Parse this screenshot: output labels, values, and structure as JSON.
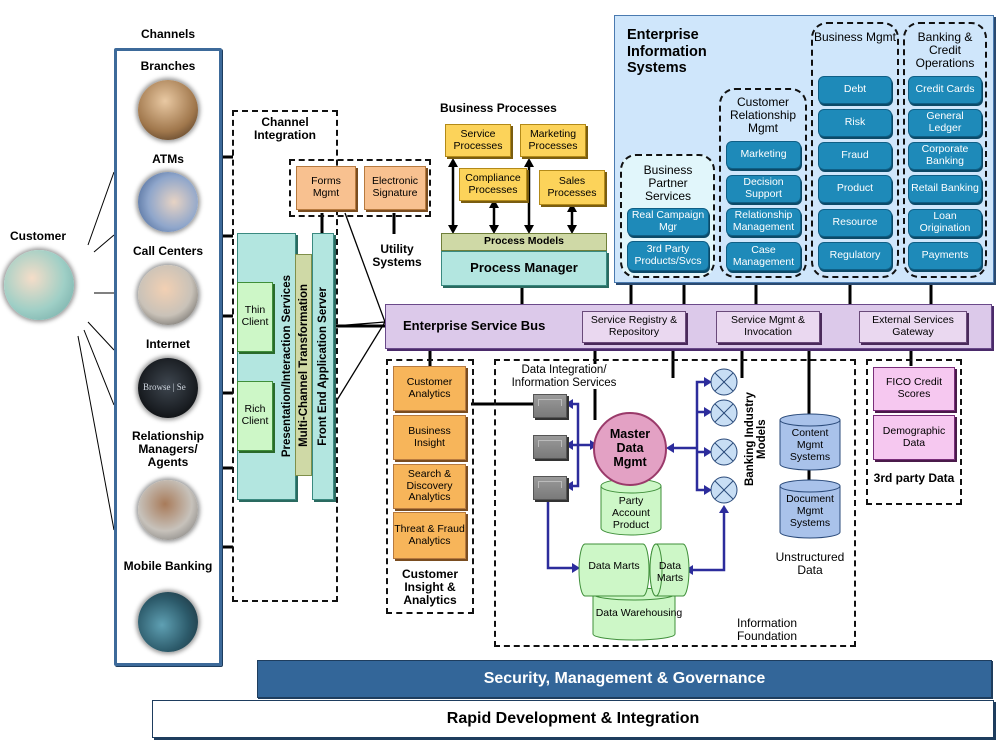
{
  "channels": {
    "title": "Channels",
    "items": [
      {
        "label": "Branches",
        "icon": "branch-photo-icon"
      },
      {
        "label": "ATMs",
        "icon": "atm-photo-icon"
      },
      {
        "label": "Call Centers",
        "icon": "call-center-photo-icon"
      },
      {
        "label": "Internet",
        "icon": "internet-browse-photo-icon"
      },
      {
        "label": "Relationship Managers/ Agents",
        "icon": "relationship-manager-photo-icon"
      },
      {
        "label": "Mobile Banking",
        "icon": "mobile-banking-photo-icon"
      }
    ]
  },
  "customer": {
    "label": "Customer",
    "icon": "customer-photo-icon"
  },
  "channel_integration": {
    "title": "Channel Integration",
    "presentation": "Presentation/Interaction Services",
    "transformation": "Multi-Channel Transformation",
    "app_server": "Front End Application Server",
    "thin_client": "Thin Client",
    "rich_client": "Rich Client"
  },
  "utility_systems": {
    "title": "Utility Systems",
    "items": [
      "Forms Mgmt",
      "Electronic Signature"
    ]
  },
  "business_processes": {
    "title": "Business Processes",
    "items": [
      "Service Processes",
      "Marketing Processes",
      "Compliance Processes",
      "Sales Processes"
    ],
    "process_models": "Process Models",
    "process_manager": "Process Manager"
  },
  "eis": {
    "title": "Enterprise Information Systems",
    "groups": [
      {
        "title": "Business Partner Services",
        "items": [
          "Real Campaign Mgr",
          "3rd Party Products/Svcs"
        ]
      },
      {
        "title": "Customer Relationship Mgmt",
        "items": [
          "Marketing",
          "Decision Support",
          "Relationship Management",
          "Case Management"
        ]
      },
      {
        "title": "Business Mgmt",
        "items": [
          "Debt",
          "Risk",
          "Fraud",
          "Product",
          "Resource",
          "Regulatory"
        ]
      },
      {
        "title": "Banking & Credit Operations",
        "items": [
          "Credit Cards",
          "General Ledger",
          "Corporate Banking",
          "Retail Banking",
          "Loan Origination",
          "Payments"
        ]
      }
    ]
  },
  "esb": {
    "title": "Enterprise Service Bus",
    "items": [
      "Service Registry & Repository",
      "Service Mgmt & Invocation",
      "External Services Gateway"
    ]
  },
  "analytics": {
    "title": "Customer Insight & Analytics",
    "items": [
      "Customer Analytics",
      "Business Insight",
      "Search & Discovery Analytics",
      "Threat & Fraud Analytics"
    ]
  },
  "information_foundation": {
    "title": "Information Foundation",
    "data_integration": "Data Integration/ Information Services",
    "mdm": "Master Data Mgmt",
    "mdm_store": "Party Account Product",
    "industry_models": "Banking Industry Models",
    "data_marts": [
      "Data Marts",
      "Data Marts"
    ],
    "warehouse": "Data Warehousing",
    "unstructured": {
      "title": "Unstructured Data",
      "items": [
        "Content Mgmt Systems",
        "Document Mgmt Systems"
      ]
    }
  },
  "third_party": {
    "title": "3rd party Data",
    "items": [
      "FICO Credit Scores",
      "Demographic Data"
    ]
  },
  "bars": {
    "security": "Security, Management & Governance",
    "rapid": "Rapid Development & Integration"
  },
  "colors": {
    "channel_border": "#3d6a9a",
    "eis_bg": "#cfe6fb",
    "teal_box": "#1e8ab9",
    "esb_bg": "#dcc9ea",
    "security_bar": "#336699",
    "mdm_circle": "#e3a1c4",
    "connector_blue": "#2c2c9c"
  }
}
